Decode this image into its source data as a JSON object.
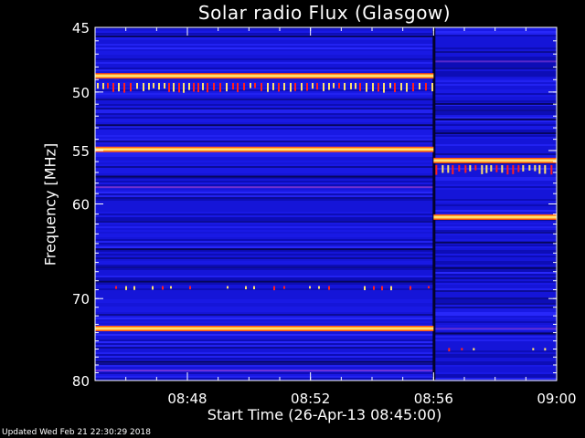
{
  "footer_text": "Updated Wed Feb 21 22:30:29 2018",
  "colors": {
    "background": "#000000",
    "frame": "#ffffff",
    "spectrogram_base": "#1515d8",
    "burst_hot": "#ffe070",
    "burst_red": "#ff2020"
  },
  "chart_data": {
    "type": "heatmap",
    "title": "Solar radio Flux (Glasgow)",
    "xlabel": "Start Time (26-Apr-13 08:45:00)",
    "ylabel": "Frequency [MHz]",
    "xlim": [
      "08:45",
      "09:00"
    ],
    "ylim": [
      45,
      80
    ],
    "y_scale": "log",
    "y_inverted": true,
    "x_ticks": [
      "08:48",
      "08:52",
      "08:56",
      "09:00"
    ],
    "y_ticks": [
      "45",
      "50",
      "55",
      "60",
      "70",
      "80"
    ],
    "data_gap_at": "08:56",
    "intense_bands": [
      {
        "freq_mhz": 48.7,
        "t_start": "08:45",
        "t_end": "08:56",
        "strength": "high"
      },
      {
        "freq_mhz": 54.9,
        "t_start": "08:45",
        "t_end": "08:56",
        "strength": "high"
      },
      {
        "freq_mhz": 73.5,
        "t_start": "08:45",
        "t_end": "08:56",
        "strength": "high"
      },
      {
        "freq_mhz": 55.9,
        "t_start": "08:56",
        "t_end": "09:00",
        "strength": "high"
      },
      {
        "freq_mhz": 61.3,
        "t_start": "08:56",
        "t_end": "09:00",
        "strength": "high"
      }
    ],
    "spike_rows": [
      {
        "freq_mhz": 49.6,
        "t_start": "08:45",
        "t_end": "08:56",
        "strength": "high"
      },
      {
        "freq_mhz": 56.7,
        "t_start": "08:56",
        "t_end": "09:00",
        "strength": "high"
      },
      {
        "freq_mhz": 68.8,
        "t_start": "08:45",
        "t_end": "08:56",
        "strength": "medium"
      },
      {
        "freq_mhz": 76.1,
        "t_start": "08:56",
        "t_end": "09:00",
        "strength": "low"
      }
    ]
  }
}
